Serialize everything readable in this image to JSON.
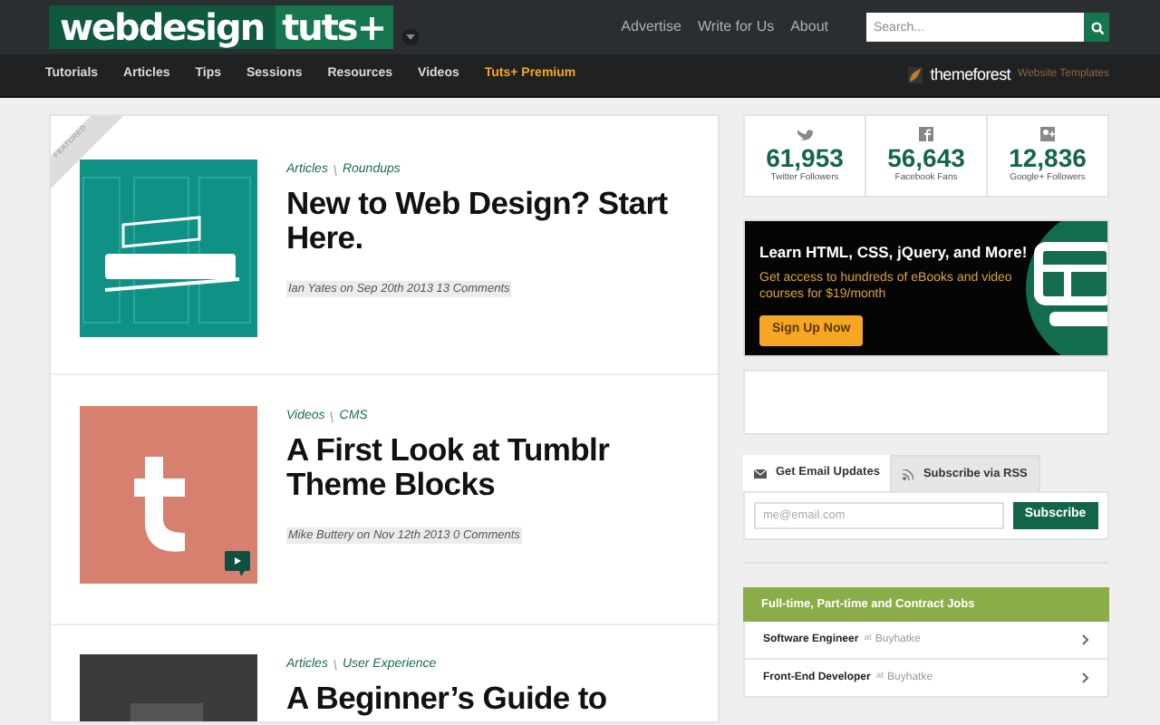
{
  "header": {
    "logo": {
      "part_1": "webdesign",
      "part_2": "tuts+"
    },
    "links": [
      "Advertise",
      "Write for Us",
      "About"
    ],
    "search": {
      "placeholder": "Search..."
    }
  },
  "nav": {
    "items": [
      {
        "label": "Tutorials",
        "kind": "normal"
      },
      {
        "label": "Articles",
        "kind": "normal"
      },
      {
        "label": "Tips",
        "kind": "normal"
      },
      {
        "label": "Sessions",
        "kind": "normal"
      },
      {
        "label": "Resources",
        "kind": "normal"
      },
      {
        "label": "Videos",
        "kind": "normal"
      },
      {
        "label": "Tuts+ Premium",
        "kind": "premium"
      }
    ],
    "partner": {
      "name": "themeforest",
      "tagline": "Website Templates"
    }
  },
  "articles": [
    {
      "featured": true,
      "ribbon": "FEATURED",
      "video": false,
      "thumb": {
        "kind": "picture"
      },
      "categories": [
        "Articles",
        "Roundups"
      ],
      "title": "New to Web Design? Start Here.",
      "meta": "Ian Yates on Sep 20th 2013 13 Comments"
    },
    {
      "featured": false,
      "video": true,
      "thumb": {
        "kind": "picture"
      },
      "categories": [
        "Videos",
        "CMS"
      ],
      "title": "A First Look at Tumblr Theme Blocks",
      "meta": "Mike Buttery on Nov 12th 2013 0 Comments"
    },
    {
      "featured": false,
      "video": false,
      "thumb": {
        "kind": "picture"
      },
      "categories": [
        "Articles",
        "User Experience"
      ],
      "title": "A Beginner’s Guide to"
    }
  ],
  "stats": [
    {
      "kind": "twitter",
      "count": "61,953",
      "label": "Twitter Followers"
    },
    {
      "kind": "facebook",
      "count": "56,643",
      "label": "Facebook Fans"
    },
    {
      "kind": "googleplus",
      "count": "12,836",
      "label": "Google+ Followers"
    }
  ],
  "promo": {
    "title": "Learn HTML, CSS, jQuery, and More!",
    "text": "Get access to hundreds of eBooks and video courses for $19/month",
    "button": "Sign Up Now"
  },
  "subscribe": {
    "tabs": [
      {
        "label": "Get Email Updates",
        "kind": "email",
        "selected": true
      },
      {
        "label": "Subscribe via RSS",
        "kind": "rss",
        "selected": false
      }
    ],
    "placeholder": "me@email.com",
    "button": "Subscribe"
  },
  "jobs": {
    "title": "Full-time, Part-time and Contract Jobs",
    "rows": [
      {
        "role": "Software Engineer",
        "at": "at",
        "company": "Buyhatke"
      },
      {
        "role": "Front-End Developer",
        "at": "at",
        "company": "Buyhatke"
      }
    ]
  }
}
